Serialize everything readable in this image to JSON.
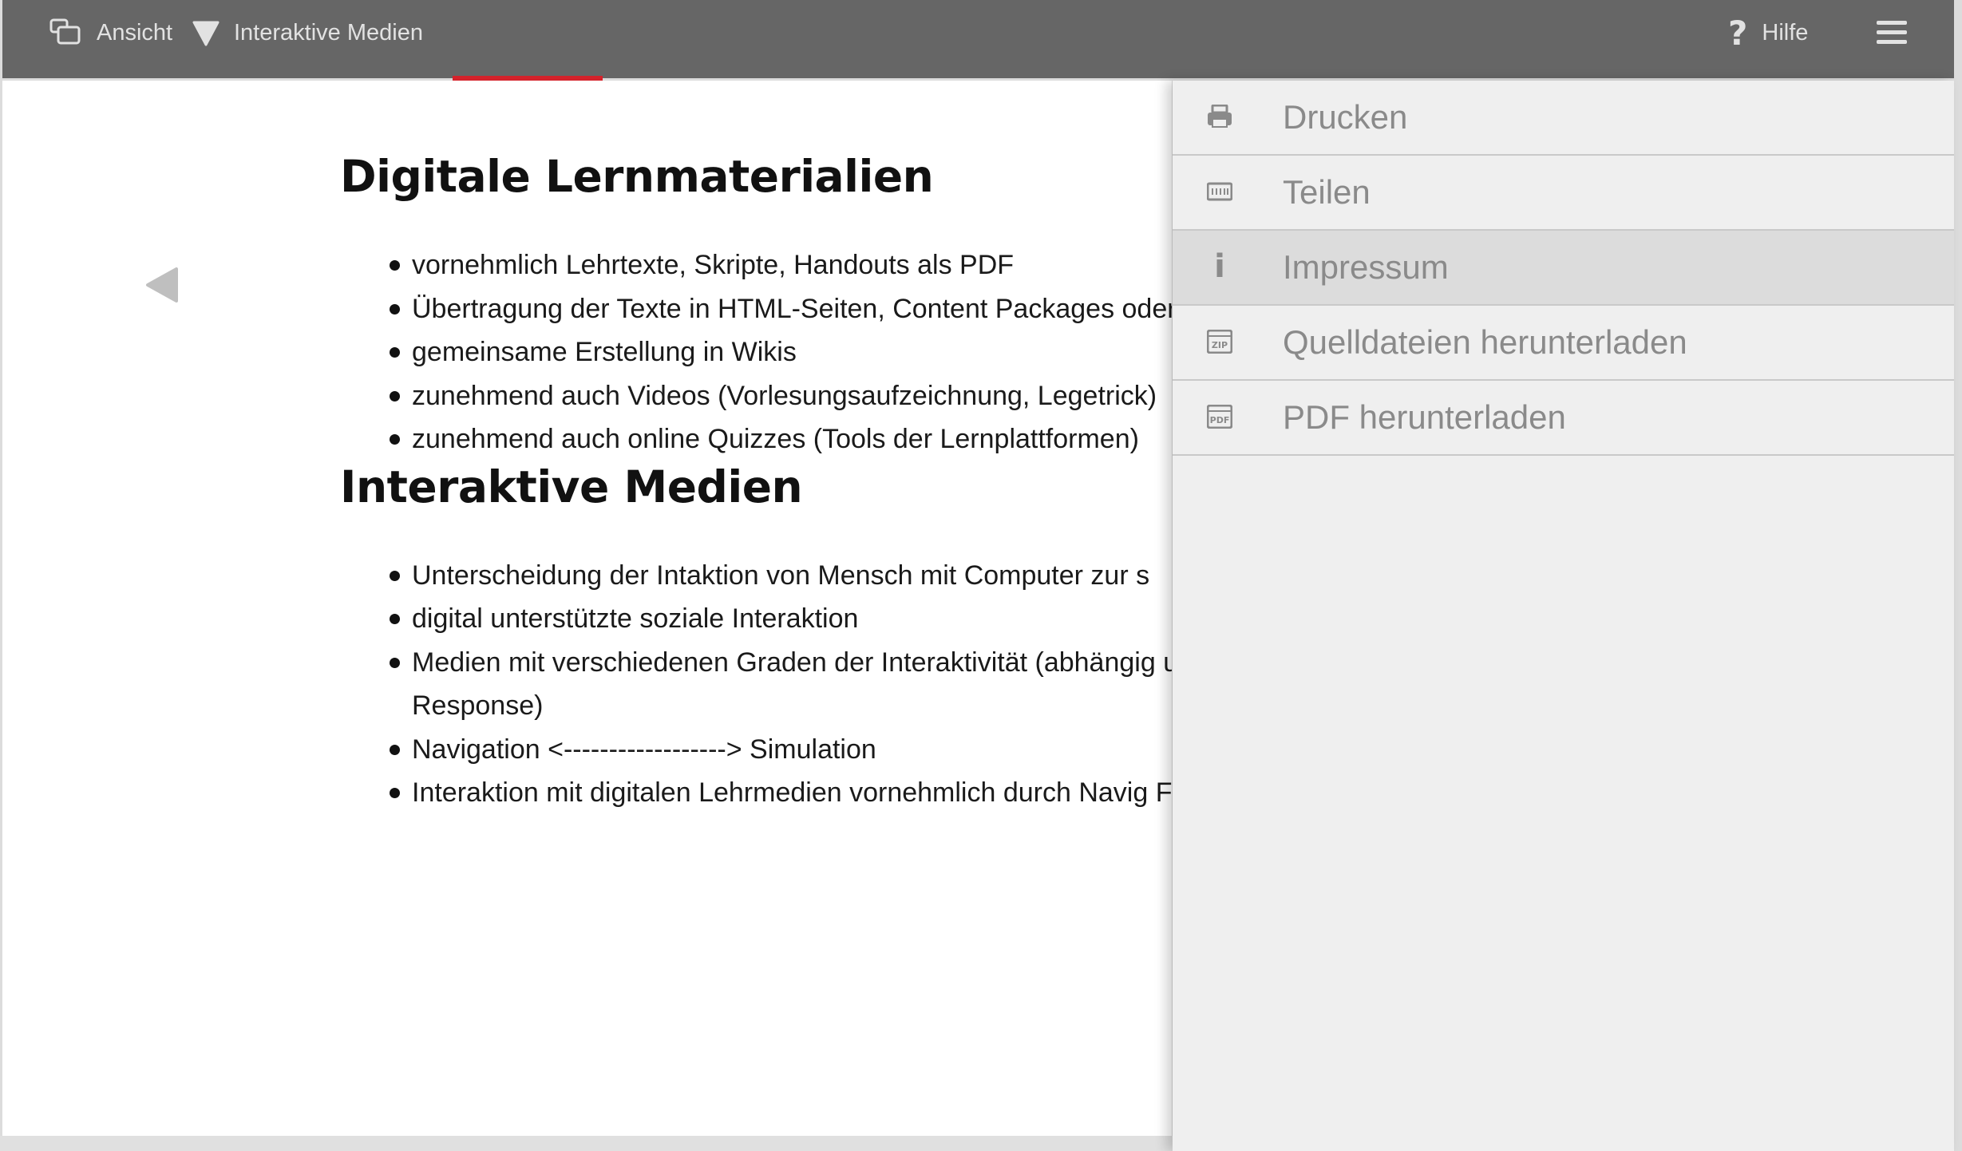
{
  "toolbar": {
    "view_label": "Ansicht",
    "breadcrumb_label": "Interaktive Medien",
    "help_label": "Hilfe"
  },
  "colors": {
    "toolbar_bg": "#666666",
    "accent_red": "#d5222b",
    "menu_bg": "#efefef",
    "menu_active_bg": "#dcdcdc"
  },
  "content": {
    "sections": [
      {
        "heading": "Digitale Lernmaterialien",
        "items": [
          "vornehmlich Lehrtexte, Skripte, Handouts als PDF",
          "Übertragung der Texte in HTML-Seiten, Content Packages oder",
          "gemeinsame Erstellung in Wikis",
          "zunehmend auch Videos (Vorlesungsaufzeichnung, Legetrick)",
          "zunehmend auch online Quizzes (Tools der Lernplattformen)"
        ]
      },
      {
        "heading": "Interaktive Medien",
        "items": [
          "Unterscheidung der Intaktion von Mensch mit Computer zur s",
          "digital unterstützte soziale Interaktion",
          "Medien mit verschiedenen Graden der Interaktivität (abhängig und Variabilität der Response)",
          "Navigation <------------------> Simulation",
          "Interaktion mit digitalen Lehrmedien vornehmlich durch Navig Feedback bei Quizzes"
        ]
      }
    ]
  },
  "menu": {
    "items": [
      {
        "label": "Drucken",
        "icon": "printer-icon"
      },
      {
        "label": "Teilen",
        "icon": "share-icon"
      },
      {
        "label": "Impressum",
        "icon": "info-icon",
        "active": true
      },
      {
        "label": "Quelldateien herunterladen",
        "icon": "zip-file-icon"
      },
      {
        "label": "PDF herunterladen",
        "icon": "pdf-file-icon"
      }
    ]
  }
}
